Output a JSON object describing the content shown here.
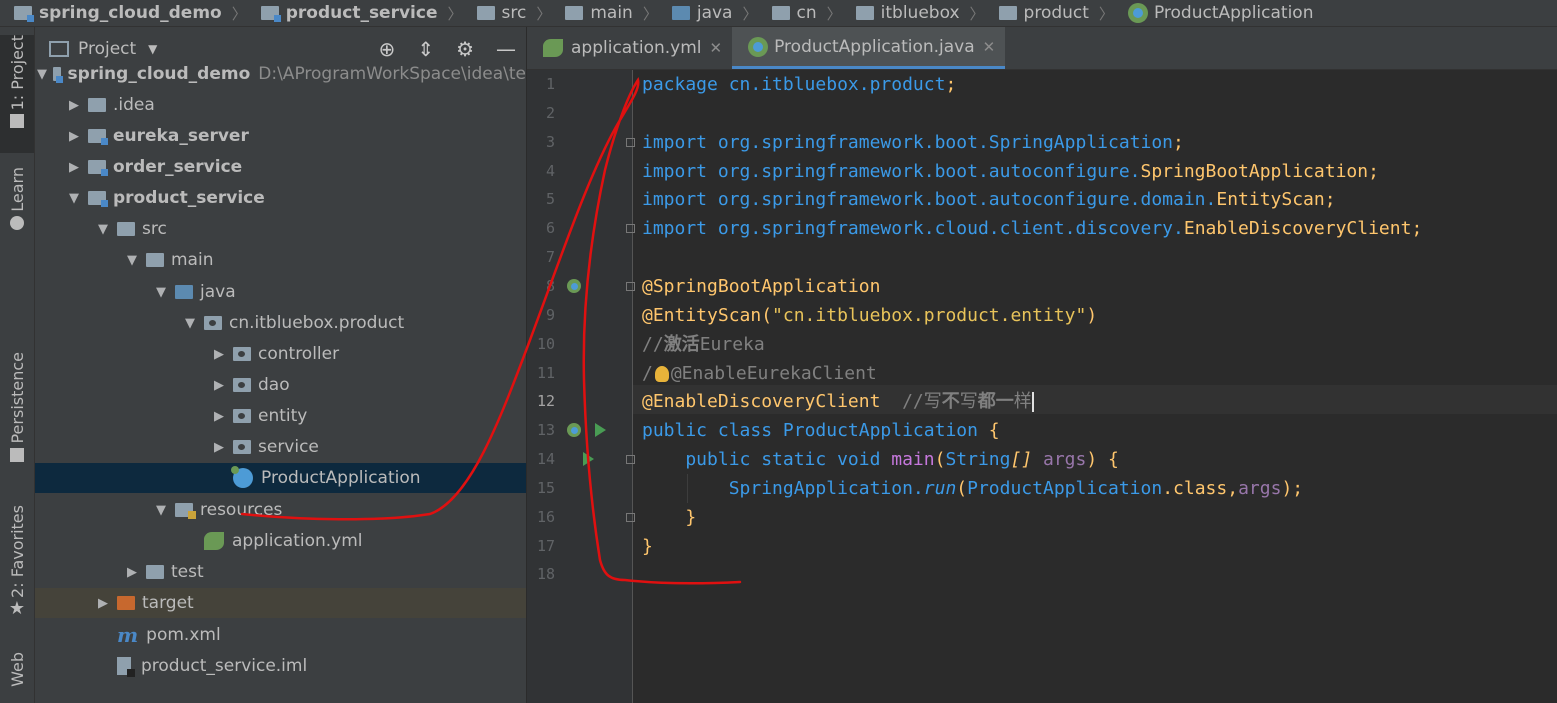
{
  "breadcrumb": [
    {
      "label": "spring_cloud_demo",
      "bold": true,
      "icon": "module-folder-icon"
    },
    {
      "label": "product_service",
      "bold": true,
      "icon": "module-folder-icon"
    },
    {
      "label": "src",
      "bold": false,
      "icon": "folder-icon"
    },
    {
      "label": "main",
      "bold": false,
      "icon": "folder-icon"
    },
    {
      "label": "java",
      "bold": false,
      "icon": "source-folder-icon"
    },
    {
      "label": "cn",
      "bold": false,
      "icon": "package-icon"
    },
    {
      "label": "itbluebox",
      "bold": false,
      "icon": "package-icon"
    },
    {
      "label": "product",
      "bold": false,
      "icon": "package-icon"
    },
    {
      "label": "ProductApplication",
      "bold": false,
      "icon": "spring-class-icon"
    }
  ],
  "left_toolbar": {
    "project": "1: Project",
    "learn": "Learn",
    "persistence": "Persistence",
    "favorites": "2: Favorites",
    "web": "Web"
  },
  "project_panel": {
    "title": "Project",
    "tree": [
      {
        "label": "spring_cloud_demo",
        "path": "D:\\AProgramWorkSpace\\idea\\te",
        "bold": true,
        "arrow": "down",
        "icon": "module",
        "indent": 0
      },
      {
        "label": ".idea",
        "bold": false,
        "arrow": "right",
        "icon": "folder",
        "indent": 1
      },
      {
        "label": "eureka_server",
        "bold": true,
        "arrow": "right",
        "icon": "module",
        "indent": 1
      },
      {
        "label": "order_service",
        "bold": true,
        "arrow": "right",
        "icon": "module",
        "indent": 1
      },
      {
        "label": "product_service",
        "bold": true,
        "arrow": "down",
        "icon": "module",
        "indent": 1
      },
      {
        "label": "src",
        "bold": false,
        "arrow": "down",
        "icon": "folder",
        "indent": 2
      },
      {
        "label": "main",
        "bold": false,
        "arrow": "down",
        "icon": "folder",
        "indent": 3
      },
      {
        "label": "java",
        "bold": false,
        "arrow": "down",
        "icon": "source",
        "indent": 4
      },
      {
        "label": "cn.itbluebox.product",
        "bold": false,
        "arrow": "down",
        "icon": "package",
        "indent": 5
      },
      {
        "label": "controller",
        "bold": false,
        "arrow": "right",
        "icon": "package",
        "indent": 6
      },
      {
        "label": "dao",
        "bold": false,
        "arrow": "right",
        "icon": "package",
        "indent": 6
      },
      {
        "label": "entity",
        "bold": false,
        "arrow": "right",
        "icon": "package",
        "indent": 6
      },
      {
        "label": "service",
        "bold": false,
        "arrow": "right",
        "icon": "package",
        "indent": 6
      },
      {
        "label": "ProductApplication",
        "bold": false,
        "arrow": "none",
        "icon": "class",
        "indent": 6,
        "selected": true
      },
      {
        "label": "resources",
        "bold": false,
        "arrow": "down",
        "icon": "resources",
        "indent": 4
      },
      {
        "label": "application.yml",
        "bold": false,
        "arrow": "none",
        "icon": "yml",
        "indent": 5
      },
      {
        "label": "test",
        "bold": false,
        "arrow": "right",
        "icon": "folder",
        "indent": 3
      },
      {
        "label": "target",
        "bold": false,
        "arrow": "right",
        "icon": "target",
        "indent": 2,
        "highlight": true
      },
      {
        "label": "pom.xml",
        "bold": false,
        "arrow": "none",
        "icon": "maven",
        "indent": 2
      },
      {
        "label": "product_service.iml",
        "bold": false,
        "arrow": "none",
        "icon": "iml",
        "indent": 2
      }
    ]
  },
  "tabs": [
    {
      "label": "application.yml",
      "active": false,
      "icon": "yml-icon"
    },
    {
      "label": "ProductApplication.java",
      "active": true,
      "icon": "spring-class-icon"
    }
  ],
  "editor": {
    "line_numbers": [
      "1",
      "2",
      "3",
      "4",
      "5",
      "6",
      "7",
      "8",
      "9",
      "10",
      "11",
      "12",
      "13",
      "14",
      "15",
      "16",
      "17",
      "18"
    ],
    "current_line": "12",
    "lines": [
      [
        {
          "t": "package ",
          "c": "kw"
        },
        {
          "t": "cn.itbluebox.product",
          "c": "pkg"
        },
        {
          "t": ";",
          "c": "yel"
        }
      ],
      [],
      [
        {
          "t": "import ",
          "c": "kw"
        },
        {
          "t": "org.springframework.boot.SpringApplication",
          "c": "pkg"
        },
        {
          "t": ";",
          "c": "yel"
        }
      ],
      [
        {
          "t": "import ",
          "c": "kw"
        },
        {
          "t": "org.springframework.boot.autoconfigure.",
          "c": "pkg"
        },
        {
          "t": "SpringBootApplication",
          "c": "cls"
        },
        {
          "t": ";",
          "c": "yel"
        }
      ],
      [
        {
          "t": "import ",
          "c": "kw"
        },
        {
          "t": "org.springframework.boot.autoconfigure.domain.",
          "c": "pkg"
        },
        {
          "t": "EntityScan",
          "c": "cls"
        },
        {
          "t": ";",
          "c": "yel"
        }
      ],
      [
        {
          "t": "import ",
          "c": "kw"
        },
        {
          "t": "org.springframework.cloud.client.discovery.",
          "c": "pkg"
        },
        {
          "t": "EnableDiscoveryClient",
          "c": "cls"
        },
        {
          "t": ";",
          "c": "yel"
        }
      ],
      [],
      [
        {
          "t": "@SpringBootApplication",
          "c": "yel"
        }
      ],
      [
        {
          "t": "@EntityScan(",
          "c": "yel"
        },
        {
          "t": "\"cn.itbluebox.product.entity\"",
          "c": "str"
        },
        {
          "t": ")",
          "c": "yel"
        }
      ],
      [
        {
          "t": "//",
          "c": "cmt"
        },
        {
          "t": "激活",
          "c": "cmtb"
        },
        {
          "t": "Eureka",
          "c": "cmt"
        }
      ],
      [
        {
          "t": "/",
          "c": "cmt"
        },
        {
          "t": "",
          "c": "bulb"
        },
        {
          "t": "@EnableEurekaClient",
          "c": "cmt"
        }
      ],
      [
        {
          "t": "@EnableDiscoveryClient",
          "c": "yel"
        },
        {
          "t": "  //写",
          "c": "cmt"
        },
        {
          "t": "不",
          "c": "cmtb"
        },
        {
          "t": "写",
          "c": "cmt"
        },
        {
          "t": "都一",
          "c": "cmtb"
        },
        {
          "t": "样",
          "c": "cmt"
        },
        {
          "t": "",
          "c": "cursor"
        }
      ],
      [
        {
          "t": "public class ",
          "c": "kw"
        },
        {
          "t": "ProductApplication ",
          "c": "pkg"
        },
        {
          "t": "{",
          "c": "yel"
        }
      ],
      [
        {
          "t": "    public static void ",
          "c": "kw"
        },
        {
          "t": "main",
          "c": "fn"
        },
        {
          "t": "(",
          "c": "yel"
        },
        {
          "t": "String",
          "c": "pkg"
        },
        {
          "t": "[] ",
          "c": "yel italic"
        },
        {
          "t": "args",
          "c": "purple"
        },
        {
          "t": ") {",
          "c": "yel"
        }
      ],
      [
        {
          "t": "        SpringApplication.",
          "c": "pkg"
        },
        {
          "t": "run",
          "c": "pkg italic"
        },
        {
          "t": "(",
          "c": "yel"
        },
        {
          "t": "ProductApplication",
          "c": "pkg"
        },
        {
          "t": ".class",
          "c": "yel"
        },
        {
          "t": ",",
          "c": "yel"
        },
        {
          "t": "args",
          "c": "purple"
        },
        {
          "t": ");",
          "c": "yel"
        }
      ],
      [
        {
          "t": "    }",
          "c": "yel"
        }
      ],
      [
        {
          "t": "}",
          "c": "yel"
        }
      ],
      []
    ]
  },
  "colors": {
    "background": "#2b2b2b",
    "panel": "#3c3f41",
    "selection": "#0d293e",
    "accent": "#4a88c7",
    "annotation_stroke": "#e01010"
  }
}
